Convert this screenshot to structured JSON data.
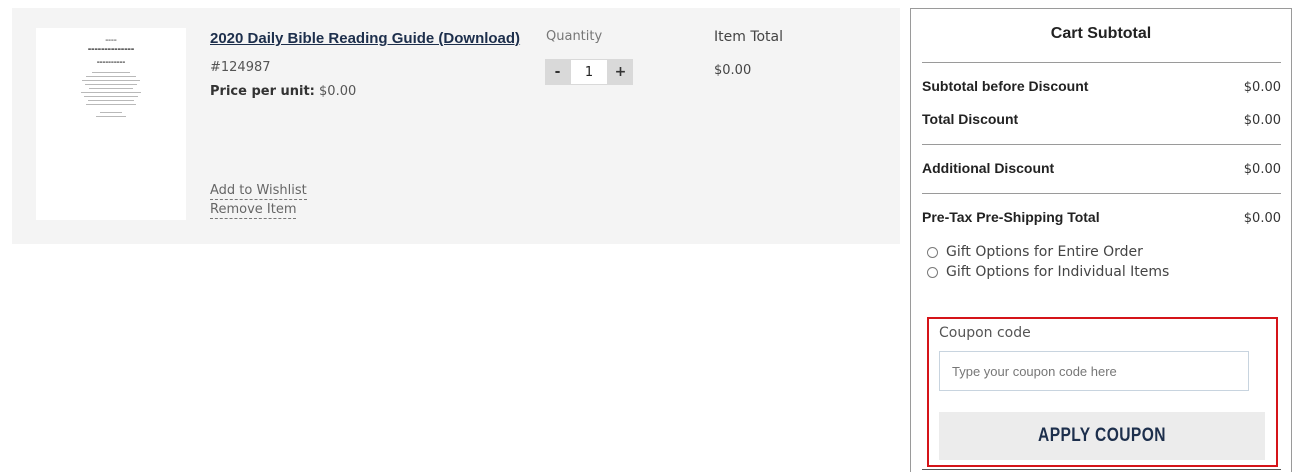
{
  "cart_item": {
    "title": "2020 Daily Bible Reading Guide (Download)",
    "sku": "#124987",
    "unit_price_label": "Price per unit:",
    "unit_price_value": "$0.00",
    "quantity_label": "Quantity",
    "quantity_value": "1",
    "decrement_label": "-",
    "increment_label": "+",
    "item_total_label": "Item Total",
    "item_total_value": "$0.00",
    "add_to_wishlist": "Add to Wishlist",
    "remove_item": "Remove Item"
  },
  "summary": {
    "title": "Cart Subtotal",
    "rows": [
      {
        "label": "Subtotal before Discount",
        "value": "$0.00"
      },
      {
        "label": "Total Discount",
        "value": "$0.00"
      },
      {
        "label": "Additional Discount",
        "value": "$0.00"
      },
      {
        "label": "Pre-Tax Pre-Shipping Total",
        "value": "$0.00"
      }
    ],
    "gift_options": [
      {
        "label": "Gift Options for Entire Order",
        "selected": false
      },
      {
        "label": "Gift Options for Individual Items",
        "selected": false
      }
    ],
    "coupon": {
      "label": "Coupon code",
      "placeholder": "Type your coupon code here",
      "value": "",
      "button": "APPLY COUPON",
      "highlight_color": "#d51419"
    }
  },
  "colors": {
    "panel_bg": "#f4f4f4",
    "link_navy": "#1d2f4c",
    "button_bg": "#ececec"
  }
}
